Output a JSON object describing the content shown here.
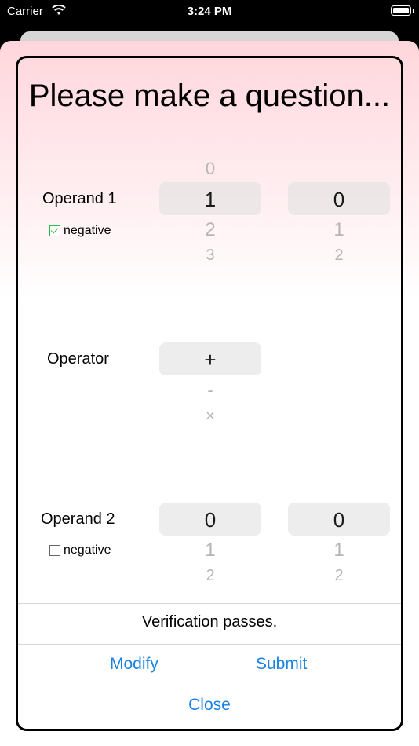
{
  "status_bar": {
    "carrier": "Carrier",
    "time": "3:24 PM"
  },
  "dialog": {
    "title": "Please make a question...",
    "operand1": {
      "label": "Operand 1",
      "negative_label": "negative",
      "negative_checked": true,
      "tens": {
        "above": "0",
        "selected": "1",
        "below": [
          "2",
          "3"
        ]
      },
      "ones": {
        "selected": "0",
        "below": [
          "1",
          "2"
        ]
      }
    },
    "operator": {
      "label": "Operator",
      "selected": "+",
      "below": [
        "-",
        "×"
      ]
    },
    "operand2": {
      "label": "Operand 2",
      "negative_label": "negative",
      "negative_checked": false,
      "tens": {
        "selected": "0",
        "below": [
          "1",
          "2"
        ]
      },
      "ones": {
        "selected": "0",
        "below": [
          "1",
          "2"
        ]
      }
    },
    "verification": "Verification passes.",
    "buttons": {
      "modify": "Modify",
      "submit": "Submit",
      "close": "Close"
    }
  }
}
